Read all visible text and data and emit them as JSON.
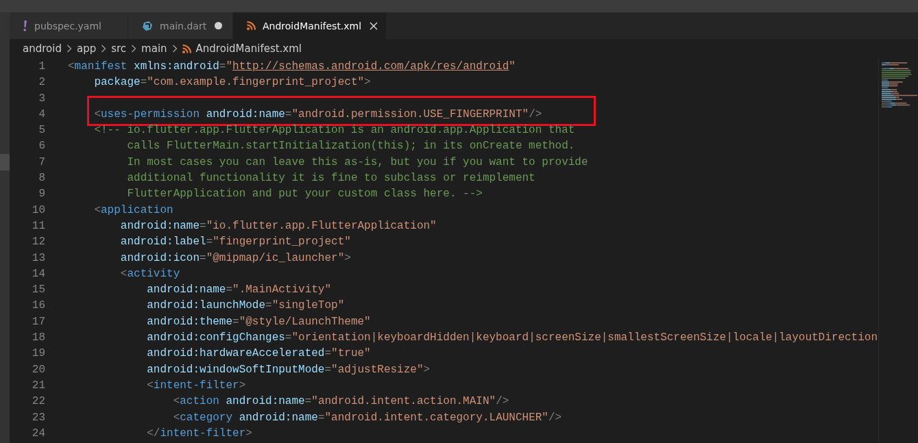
{
  "tabs": [
    {
      "label": "pubspec.yaml",
      "kind": "yaml",
      "selected": false,
      "modified": false
    },
    {
      "label": "main.dart",
      "kind": "dart",
      "selected": false,
      "modified": true
    },
    {
      "label": "AndroidManifest.xml",
      "kind": "xml",
      "selected": true,
      "modified": false
    }
  ],
  "breadcrumbs": [
    {
      "label": "android",
      "kind": "folder"
    },
    {
      "label": "app",
      "kind": "folder"
    },
    {
      "label": "src",
      "kind": "folder"
    },
    {
      "label": "main",
      "kind": "folder"
    },
    {
      "label": "AndroidManifest.xml",
      "kind": "xml"
    }
  ],
  "lines": [
    {
      "number": "1",
      "annotated": false,
      "tokens": [
        {
          "kind": "punct",
          "text": "<"
        },
        {
          "kind": "tag",
          "text": "manifest "
        },
        {
          "kind": "attr",
          "text": "xmlns:android"
        },
        {
          "kind": "punct",
          "text": "="
        },
        {
          "kind": "str",
          "text": "\""
        },
        {
          "kind": "link",
          "text": "http://schemas.android.com/apk/res/android"
        },
        {
          "kind": "str",
          "text": "\""
        }
      ]
    },
    {
      "number": "2",
      "annotated": false,
      "tokens": [
        {
          "kind": "attr",
          "text": "    package"
        },
        {
          "kind": "punct",
          "text": "="
        },
        {
          "kind": "str",
          "text": "\"com.example.fingerprint_project\""
        },
        {
          "kind": "punct",
          "text": ">"
        }
      ]
    },
    {
      "number": "3",
      "annotated": false
    },
    {
      "number": "4",
      "annotated": true,
      "tokens": [
        {
          "kind": "punct",
          "text": "    <"
        },
        {
          "kind": "tag",
          "text": "uses-permission "
        },
        {
          "kind": "attr",
          "text": "android:name"
        },
        {
          "kind": "punct",
          "text": "="
        },
        {
          "kind": "str",
          "text": "\"android.permission.USE_FINGERPRINT\""
        },
        {
          "kind": "punct",
          "text": "/>"
        }
      ]
    },
    {
      "number": "5",
      "annotated": false,
      "tokens": [
        {
          "kind": "comment",
          "text": "    <!-- io.flutter.app.FlutterApplication is an android.app.Application that"
        }
      ]
    },
    {
      "number": "6",
      "annotated": false,
      "tokens": [
        {
          "kind": "comment",
          "text": "         calls FlutterMain.startInitialization(this); in its onCreate method."
        }
      ]
    },
    {
      "number": "7",
      "annotated": false,
      "tokens": [
        {
          "kind": "comment",
          "text": "         In most cases you can leave this as-is, but you if you want to provide"
        }
      ]
    },
    {
      "number": "8",
      "annotated": false,
      "tokens": [
        {
          "kind": "comment",
          "text": "         additional functionality it is fine to subclass or reimplement"
        }
      ]
    },
    {
      "number": "9",
      "annotated": false,
      "tokens": [
        {
          "kind": "comment",
          "text": "         FlutterApplication and put your custom class here. -->"
        }
      ]
    },
    {
      "number": "10",
      "annotated": false,
      "tokens": [
        {
          "kind": "punct",
          "text": "    <"
        },
        {
          "kind": "tag",
          "text": "application"
        }
      ]
    },
    {
      "number": "11",
      "annotated": false,
      "tokens": [
        {
          "kind": "attr",
          "text": "        android:name"
        },
        {
          "kind": "punct",
          "text": "="
        },
        {
          "kind": "str",
          "text": "\"io.flutter.app.FlutterApplication\""
        }
      ]
    },
    {
      "number": "12",
      "annotated": false,
      "tokens": [
        {
          "kind": "attr",
          "text": "        android:label"
        },
        {
          "kind": "punct",
          "text": "="
        },
        {
          "kind": "str",
          "text": "\"fingerprint_project\""
        }
      ]
    },
    {
      "number": "13",
      "annotated": false,
      "tokens": [
        {
          "kind": "attr",
          "text": "        android:icon"
        },
        {
          "kind": "punct",
          "text": "="
        },
        {
          "kind": "str",
          "text": "\"@mipmap/ic_launcher\""
        },
        {
          "kind": "punct",
          "text": ">"
        }
      ]
    },
    {
      "number": "14",
      "annotated": false,
      "tokens": [
        {
          "kind": "punct",
          "text": "        <"
        },
        {
          "kind": "tag",
          "text": "activity"
        }
      ]
    },
    {
      "number": "15",
      "annotated": false,
      "tokens": [
        {
          "kind": "attr",
          "text": "            android:name"
        },
        {
          "kind": "punct",
          "text": "="
        },
        {
          "kind": "str",
          "text": "\".MainActivity\""
        }
      ]
    },
    {
      "number": "16",
      "annotated": false,
      "tokens": [
        {
          "kind": "attr",
          "text": "            android:launchMode"
        },
        {
          "kind": "punct",
          "text": "="
        },
        {
          "kind": "str",
          "text": "\"singleTop\""
        }
      ]
    },
    {
      "number": "17",
      "annotated": false,
      "tokens": [
        {
          "kind": "attr",
          "text": "            android:theme"
        },
        {
          "kind": "punct",
          "text": "="
        },
        {
          "kind": "str",
          "text": "\"@style/LaunchTheme\""
        }
      ]
    },
    {
      "number": "18",
      "annotated": false,
      "tokens": [
        {
          "kind": "attr",
          "text": "            android:configChanges"
        },
        {
          "kind": "punct",
          "text": "="
        },
        {
          "kind": "str",
          "text": "\"orientation|keyboardHidden|keyboard|screenSize|smallestScreenSize|locale|layoutDirection"
        }
      ]
    },
    {
      "number": "19",
      "annotated": false,
      "tokens": [
        {
          "kind": "attr",
          "text": "            android:hardwareAccelerated"
        },
        {
          "kind": "punct",
          "text": "="
        },
        {
          "kind": "str",
          "text": "\"true\""
        }
      ]
    },
    {
      "number": "20",
      "annotated": false,
      "tokens": [
        {
          "kind": "attr",
          "text": "            android:windowSoftInputMode"
        },
        {
          "kind": "punct",
          "text": "="
        },
        {
          "kind": "str",
          "text": "\"adjustResize\""
        },
        {
          "kind": "punct",
          "text": ">"
        }
      ]
    },
    {
      "number": "21",
      "annotated": false,
      "tokens": [
        {
          "kind": "punct",
          "text": "            <"
        },
        {
          "kind": "tag",
          "text": "intent-filter"
        },
        {
          "kind": "punct",
          "text": ">"
        }
      ]
    },
    {
      "number": "22",
      "annotated": false,
      "tokens": [
        {
          "kind": "punct",
          "text": "                <"
        },
        {
          "kind": "tag",
          "text": "action "
        },
        {
          "kind": "attr",
          "text": "android:name"
        },
        {
          "kind": "punct",
          "text": "="
        },
        {
          "kind": "str",
          "text": "\"android.intent.action.MAIN\""
        },
        {
          "kind": "punct",
          "text": "/>"
        }
      ]
    },
    {
      "number": "23",
      "annotated": false,
      "tokens": [
        {
          "kind": "punct",
          "text": "                <"
        },
        {
          "kind": "tag",
          "text": "category "
        },
        {
          "kind": "attr",
          "text": "android:name"
        },
        {
          "kind": "punct",
          "text": "="
        },
        {
          "kind": "str",
          "text": "\"android.intent.category.LAUNCHER\""
        },
        {
          "kind": "punct",
          "text": "/>"
        }
      ]
    },
    {
      "number": "24",
      "annotated": false,
      "tokens": [
        {
          "kind": "punct",
          "text": "            </"
        },
        {
          "kind": "tag",
          "text": "intent-filter"
        },
        {
          "kind": "punct",
          "text": ">"
        }
      ]
    }
  ]
}
